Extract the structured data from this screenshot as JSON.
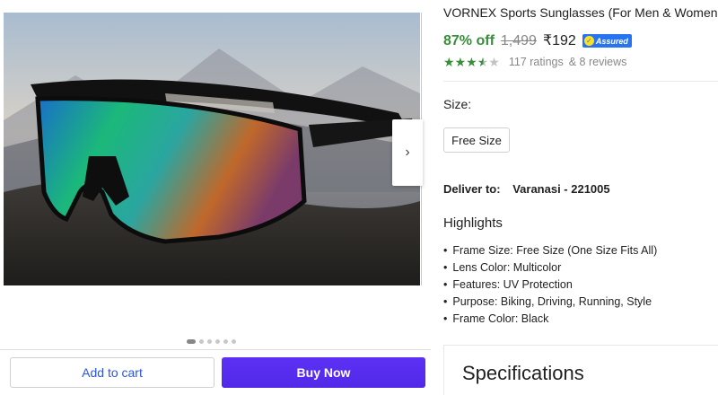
{
  "product": {
    "title": "VORNEX Sports Sunglasses (For Men & Women,",
    "discount": "87% off",
    "mrp": "1,499",
    "price": "₹192",
    "assured_label": "Assured",
    "rating_stars": 3.5,
    "ratings_text": "117 ratings",
    "reviews_text": "& 8 reviews"
  },
  "gallery": {
    "next_icon": "chevron-right-icon",
    "image_count": 6,
    "active_index": 0
  },
  "size": {
    "label": "Size:",
    "selected": "Free Size"
  },
  "delivery": {
    "label": "Deliver to:",
    "location": "Varanasi - 221005"
  },
  "highlights": {
    "title": "Highlights",
    "items": [
      "Frame Size: Free Size (One Size Fits All)",
      "Lens Color: Multicolor",
      "Features: UV Protection",
      "Purpose: Biking, Driving, Running, Style",
      "Frame Color: Black"
    ]
  },
  "actions": {
    "add_to_cart": "Add to cart",
    "buy_now": "Buy Now"
  },
  "specifications": {
    "title": "Specifications"
  },
  "colors": {
    "green": "#388e3c",
    "brand_blue": "#2874f0",
    "buy_purple": "#5a2ff2"
  }
}
